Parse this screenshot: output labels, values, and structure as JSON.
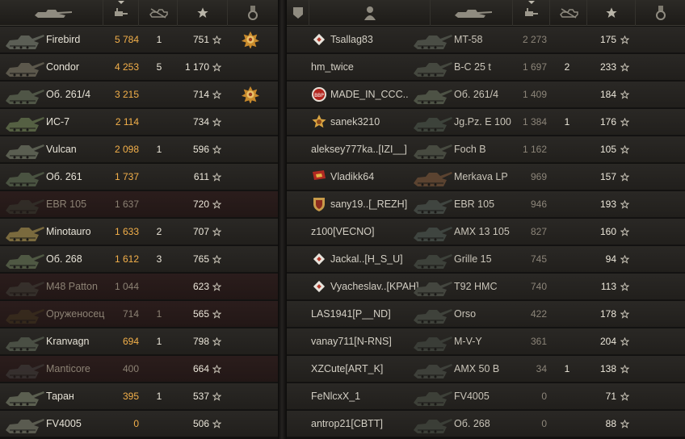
{
  "left": {
    "header": {
      "tank_icon": "tank-icon",
      "damage_icon": "damage-icon",
      "destroyed_icon": "destroyed-tank-icon",
      "xp_icon": "star-icon",
      "medal_icon": "medal-icon"
    },
    "rows": [
      {
        "tank": "Firebird",
        "damage": "5 784",
        "kills": "1",
        "xp": "751",
        "medal": "gold",
        "dead": false
      },
      {
        "tank": "Condor",
        "damage": "4 253",
        "kills": "5",
        "xp": "1 170",
        "medal": "",
        "dead": false
      },
      {
        "tank": "Об. 261/4",
        "damage": "3 215",
        "kills": "",
        "xp": "714",
        "medal": "gold",
        "dead": false
      },
      {
        "tank": "ИС-7",
        "damage": "2 114",
        "kills": "",
        "xp": "734",
        "medal": "",
        "dead": false
      },
      {
        "tank": "Vulcan",
        "damage": "2 098",
        "kills": "1",
        "xp": "596",
        "medal": "",
        "dead": false
      },
      {
        "tank": "Об. 261",
        "damage": "1 737",
        "kills": "",
        "xp": "611",
        "medal": "",
        "dead": false
      },
      {
        "tank": "EBR 105",
        "damage": "1 637",
        "kills": "",
        "xp": "720",
        "medal": "",
        "dead": true
      },
      {
        "tank": "Minotauro",
        "damage": "1 633",
        "kills": "2",
        "xp": "707",
        "medal": "",
        "dead": false
      },
      {
        "tank": "Об. 268",
        "damage": "1 612",
        "kills": "3",
        "xp": "765",
        "medal": "",
        "dead": false
      },
      {
        "tank": "M48 Patton",
        "damage": "1 044",
        "kills": "",
        "xp": "623",
        "medal": "",
        "dead": true
      },
      {
        "tank": "Оруженосец",
        "damage": "714",
        "kills": "1",
        "xp": "565",
        "medal": "",
        "dead": true
      },
      {
        "tank": "Kranvagn",
        "damage": "694",
        "kills": "1",
        "xp": "798",
        "medal": "",
        "dead": false
      },
      {
        "tank": "Manticore",
        "damage": "400",
        "kills": "",
        "xp": "664",
        "medal": "",
        "dead": true
      },
      {
        "tank": "Таран",
        "damage": "395",
        "kills": "1",
        "xp": "537",
        "medal": "",
        "dead": false
      },
      {
        "tank": "FV4005",
        "damage": "0",
        "kills": "",
        "xp": "506",
        "medal": "",
        "dead": false
      }
    ]
  },
  "right": {
    "header": {
      "platoon_icon": "platoon-icon",
      "player_icon": "player-icon",
      "tank_icon": "tank-icon",
      "damage_icon": "damage-icon",
      "destroyed_icon": "destroyed-tank-icon",
      "xp_icon": "star-icon",
      "medal_icon": "medal-icon"
    },
    "rows": [
      {
        "badge": "diamond",
        "player": "Tsallag83",
        "tank": "MT-58",
        "damage": "2 273",
        "kills": "",
        "xp": "175"
      },
      {
        "badge": "",
        "player": "hm_twice",
        "tank": "B-C 25 t",
        "damage": "1 697",
        "kills": "2",
        "xp": "233"
      },
      {
        "badge": "bbr",
        "player": "MADE_IN_CCC..",
        "tank": "Об. 261/4",
        "damage": "1 409",
        "kills": "",
        "xp": "184"
      },
      {
        "badge": "gold-star",
        "player": "sanek3210",
        "tank": "Jg.Pz. E 100",
        "damage": "1 384",
        "kills": "1",
        "xp": "176"
      },
      {
        "badge": "",
        "player": "aleksey777ka..[IZI__]",
        "tank": "Foch B",
        "damage": "1 162",
        "kills": "",
        "xp": "105"
      },
      {
        "badge": "red-flag",
        "player": "Vladikk64",
        "tank": "Merkava LP",
        "damage": "969",
        "kills": "",
        "xp": "157"
      },
      {
        "badge": "shield",
        "player": "sany19..[_REZH]",
        "tank": "EBR 105",
        "damage": "946",
        "kills": "",
        "xp": "193"
      },
      {
        "badge": "",
        "player": "z100[VECNO]",
        "tank": "AMX 13 105",
        "damage": "827",
        "kills": "",
        "xp": "160"
      },
      {
        "badge": "diamond",
        "player": "Jackal..[H_S_U]",
        "tank": "Grille 15",
        "damage": "745",
        "kills": "",
        "xp": "94"
      },
      {
        "badge": "diamond",
        "player": "Vyacheslav..[KPAH]",
        "tank": "T92 HMC",
        "damage": "740",
        "kills": "",
        "xp": "113"
      },
      {
        "badge": "",
        "player": "LAS1941[P__ND]",
        "tank": "Orso",
        "damage": "422",
        "kills": "",
        "xp": "178"
      },
      {
        "badge": "",
        "player": "vanay711[N-RNS]",
        "tank": "M-V-Y",
        "damage": "361",
        "kills": "",
        "xp": "204"
      },
      {
        "badge": "",
        "player": "XZCute[ART_K]",
        "tank": "AMX 50 B",
        "damage": "34",
        "kills": "1",
        "xp": "138"
      },
      {
        "badge": "",
        "player": "FeNlcxX_1",
        "tank": "FV4005",
        "damage": "0",
        "kills": "",
        "xp": "71"
      },
      {
        "badge": "",
        "player": "antrop21[CBTT]",
        "tank": "Об. 268",
        "damage": "0",
        "kills": "",
        "xp": "88"
      }
    ]
  },
  "colors": {
    "damage_highlight": "#f3b04a",
    "damage_dim": "#8c8579",
    "row_alive": "#2a2825",
    "row_dead": "#2b1d1c"
  }
}
